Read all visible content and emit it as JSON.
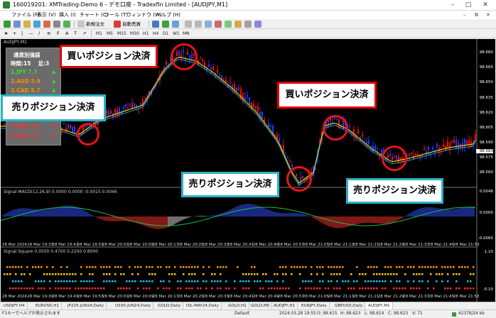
{
  "window": {
    "title": "160019201: XMTrading-Demo 6 - デモ口座 - Tradexfin Limited - [AUDJPY,M1]"
  },
  "menu": [
    "ファイル (F)",
    "表示 (V)",
    "挿入 (I)",
    "チャート (C)",
    "ツール (T)",
    "ウィンドウ (W)",
    "ヘルプ (H)"
  ],
  "toolbar": {
    "new_order": "新規注文",
    "auto_trade": "自動売買",
    "timeframes": [
      "M1",
      "M5",
      "M15",
      "M30",
      "H1",
      "H4",
      "D1",
      "W1",
      "MN"
    ]
  },
  "chart": {
    "window_label": "AUDJPY,M1",
    "price_labels": [
      "98.680",
      "98.665",
      "98.650",
      "98.635",
      "98.620",
      "98.605",
      "98.590",
      "98.575",
      "98.560"
    ],
    "current_price": "98.583",
    "macd_label": "Signal MACD(12,26,9) 0.0000 0.0000 -0.0015 0.0046",
    "macd_scale": [
      "0.0048",
      "0.0000",
      "-0.0065"
    ],
    "square_label": "Signal Square 0.0500 0.4700 0.2200 0.8000",
    "square_scale": [
      "1.10",
      "-0.10"
    ],
    "time_labels_top": [
      "28 Mar 2024",
      "28 Mar 19:30",
      "28 Mar 19:43",
      "28 Mar 19:53",
      "28 Mar 20:01",
      "28 Mar 20:09",
      "28 Mar 20:17",
      "28 Mar 20:25",
      "28 Mar 20:33",
      "28 Mar 20:41",
      "28 Mar 20:49",
      "28 Mar 20:57",
      "28 Mar 21:05",
      "28 Mar 21:13",
      "28 Mar 21:21",
      "28 Mar 21:29",
      "28 Mar 21:37",
      "28 Mar 21:45",
      "28 Mar 21:53"
    ],
    "time_labels_mid": [
      "28 Mar 2024",
      "28 Mar 19:33",
      "28 Mar 19:43",
      "28 Mar 19:53",
      "28 Mar 20:01",
      "28 Mar 20:09",
      "28 Mar 20:17",
      "28 Mar 20:25",
      "28 Mar 20:33",
      "28 Mar 20:41",
      "28 Mar 20:49",
      "28 Mar 20:57",
      "28 Mar 21:05",
      "28 Mar 21:13",
      "28 Mar 21:21",
      "28 Mar 21:29",
      "28 Mar 21:37",
      "28 Mar 21:45",
      "28 Mar 21:53"
    ]
  },
  "strength_panel": {
    "title": "通貨別強弱",
    "subtitle": "時間:15 　足:3",
    "rows": [
      {
        "text": "1.JPY 7.7",
        "color": "#33dd33",
        "arrow": "▲",
        "arrow_color": "#33dd33"
      },
      {
        "text": "2.AUD 5.9",
        "color": "#ff8c00",
        "arrow": "▲",
        "arrow_color": "#33dd33"
      },
      {
        "text": "3.CAD 5.7",
        "color": "#ff8c00",
        "arrow": "▲",
        "arrow_color": "#33dd33"
      },
      {
        "text": "7.CHF 3.1",
        "color": "#ff3030",
        "arrow": "▼",
        "arrow_color": "#ff3030"
      },
      {
        "text": "8.EUR 3.1",
        "color": "#ff3030",
        "arrow": "▼",
        "arrow_color": "#ff3030"
      }
    ]
  },
  "callouts": {
    "buy1": "買いポジション決済",
    "sell1": "売りポジション決済",
    "sell2": "売りポジション決済",
    "buy2": "買いポジション決済",
    "sell3": "売りポジション決済"
  },
  "tabs": [
    "USDJPY,H4",
    "EURUSD,H1",
    "JP225-JUN24,Daily",
    "US30-JUN24,Daily",
    "GOLD,Daily",
    "OIL-MAY24,Daily",
    "GOLD,H1",
    "GOLD,M5",
    "AUDJPY,H1",
    "EURJPY,Daily",
    "GBPUSD,Daily",
    "AUDJPY,M1"
  ],
  "status": {
    "help": "F1キーでヘルプが表示されます",
    "profile": "Default",
    "datetime": "2024.03.28 19:55",
    "open": "O: 98.615",
    "high": "H: 98.623",
    "low": "L: 98.614",
    "close": "C: 98.623",
    "volume": "V: 71",
    "traffic": "42378/24 kb"
  },
  "colors": {
    "bull": "#1e3cff",
    "bear": "#e81010",
    "ma": "#f0d000",
    "ma2": "#2fb8e6"
  }
}
